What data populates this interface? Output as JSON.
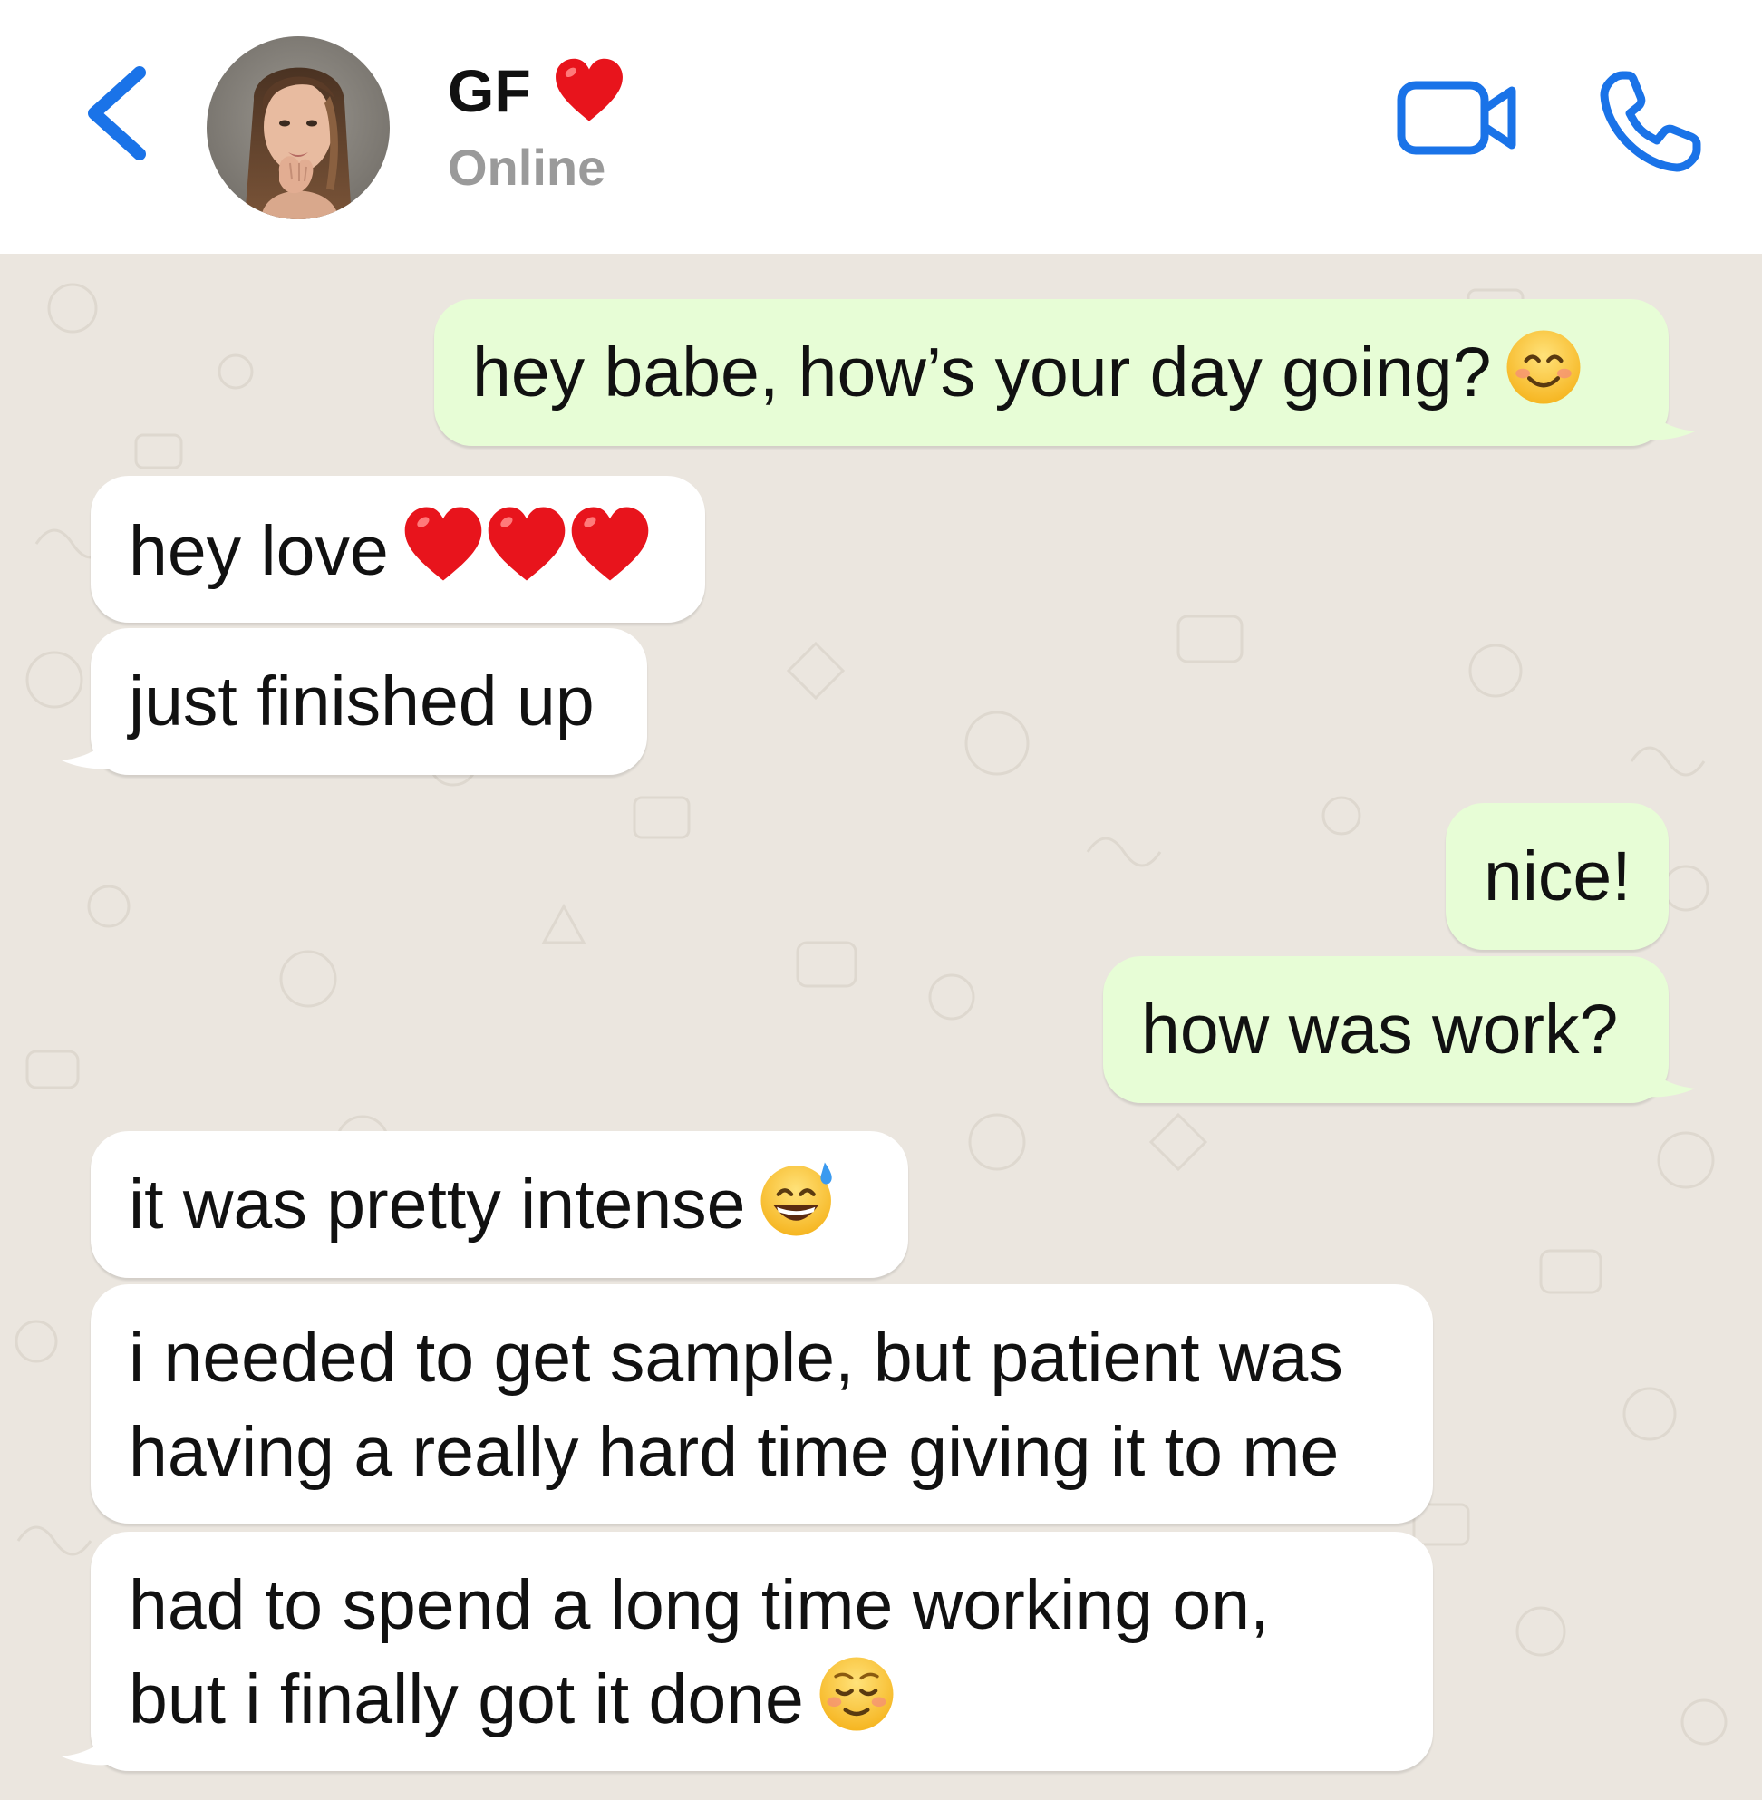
{
  "header": {
    "contact_name": "GF",
    "status": "Online",
    "name_emoji": "red-heart",
    "avatar": "contact-photo"
  },
  "colors": {
    "accent": "#1a73e8",
    "outgoing_bubble": "#e7fdd6",
    "incoming_bubble": "#ffffff",
    "chat_background": "#ebe6df",
    "status_text": "#9a9a9a"
  },
  "messages": [
    {
      "direction": "outgoing",
      "text": "hey babe, how’s your day going?",
      "emoji": "smiling-face-with-smiling-eyes"
    },
    {
      "direction": "incoming",
      "text": "hey love",
      "emoji": "red-heart x3"
    },
    {
      "direction": "incoming",
      "text": "just finished up"
    },
    {
      "direction": "outgoing",
      "text": "nice!"
    },
    {
      "direction": "outgoing",
      "text": "how was work?"
    },
    {
      "direction": "incoming",
      "text": "it was pretty intense",
      "emoji": "grinning-face-with-sweat"
    },
    {
      "direction": "incoming",
      "lines": [
        "i needed to get sample, but patient was",
        "having a really hard time giving it to me"
      ]
    },
    {
      "direction": "incoming",
      "lines": [
        "had to spend a long time working on,",
        "but i finally got it done"
      ],
      "emoji": "relieved-face"
    }
  ]
}
